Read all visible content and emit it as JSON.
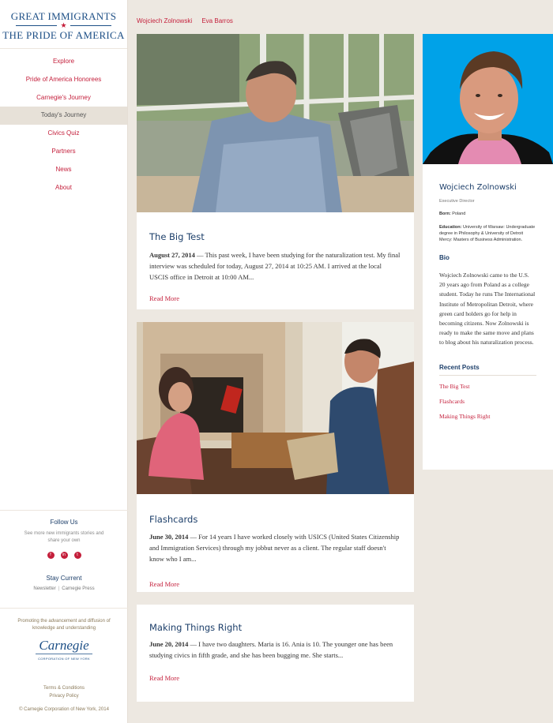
{
  "logo": {
    "line1": "GREAT IMMIGRANTS",
    "star": "★",
    "line2": "THE PRIDE OF AMERICA"
  },
  "nav": [
    {
      "label": "Explore"
    },
    {
      "label": "Pride of America Honorees"
    },
    {
      "label": "Carnegie's Journey"
    },
    {
      "label": "Today's Journey",
      "active": true
    },
    {
      "label": "Civics Quiz"
    },
    {
      "label": "Partners"
    },
    {
      "label": "News"
    },
    {
      "label": "About"
    }
  ],
  "follow": {
    "heading": "Follow Us",
    "sub": "See more new immigrants stories and share your own",
    "social": [
      "f",
      "in",
      "t"
    ]
  },
  "stay": {
    "heading": "Stay Current",
    "links": [
      "Newsletter",
      "Carnegie Press"
    ]
  },
  "promo": {
    "text": "Promoting the advancement and diffusion of knowledge and understanding",
    "logo_name": "Carnegie",
    "logo_sub": "CORPORATION OF NEW YORK"
  },
  "footer": {
    "terms": "Terms & Conditions",
    "privacy": "Privacy Policy",
    "copyright": "© Carnegie Corporation of New York, 2014"
  },
  "top_names": [
    "Wojciech Zolnowski",
    "Eva Barros"
  ],
  "posts": [
    {
      "title": "The Big Test",
      "date": "August 27, 2014",
      "excerpt": " — This past week, I have been studying for the naturalization test. My final interview was scheduled for today, August 27, 2014 at 10:25 AM. I arrived at the local USCIS office in Detroit at 10:00 AM...",
      "more": "Read More"
    },
    {
      "title": "Flashcards",
      "date": "June 30, 2014",
      "excerpt": " — For 14 years I have worked closely with USICS (United States Citizenship and Immigration Services) through my jobbut never as a client. The regular staff doesn't know who I am...",
      "more": "Read More"
    },
    {
      "title": "Making Things Right",
      "date": "June 20, 2014",
      "excerpt": " — I have two daughters. Maria is 16. Ania is 10. The younger one has been studying civics in fifth grade, and she has been bugging me. She starts...",
      "more": "Read More"
    }
  ],
  "profile": {
    "name": "Wojciech Zolnowski",
    "title": "Executive Director",
    "born_label": "Born:",
    "born": " Poland",
    "education_label": "Education:",
    "education": " University of Warsaw: Undergraduate degree in Philosophy & University of Detroit Mercy: Masters of Business Administration.",
    "bio_heading": "Bio",
    "bio": "Wojciech Zolnowski came to the U.S. 20 years ago from Poland as a college student. Today he runs The International Institute of Metropolitan Detroit, where green card holders go for help in becoming citizens. Now Zolnowski is ready to make the same move and plans to blog about his naturalization process.",
    "recent_heading": "Recent Posts",
    "recent": [
      "The Big Test",
      "Flashcards",
      "Making Things Right"
    ]
  },
  "colors": {
    "brand_blue": "#1d4f86",
    "accent_red": "#c41f3b",
    "background": "#ede8e1",
    "portrait_bg": "#00a2e8"
  }
}
